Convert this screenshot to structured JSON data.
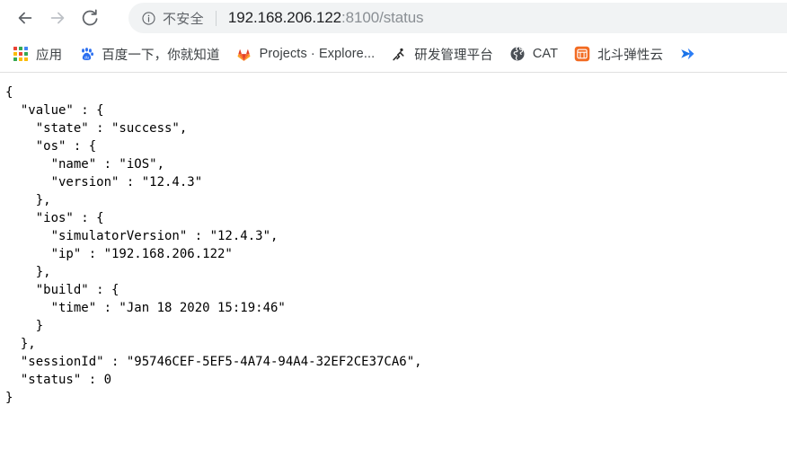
{
  "browser": {
    "nav": {
      "back_label": "Back",
      "back_icon": "arrow-left-icon",
      "forward_label": "Forward",
      "forward_icon": "arrow-right-icon",
      "reload_label": "Reload",
      "reload_icon": "reload-icon"
    },
    "omnibox": {
      "security_icon": "info-circle-icon",
      "security_label": "不安全",
      "url_host": "192.168.206.122",
      "url_rest": ":8100/status",
      "full_url": "192.168.206.122:8100/status"
    },
    "bookmarks": [
      {
        "icon": "apps-grid-icon",
        "label": "应用"
      },
      {
        "icon": "baidu-paw-icon",
        "label": "百度一下，你就知道"
      },
      {
        "icon": "gitlab-fox-icon",
        "label": "Projects · Explore..."
      },
      {
        "icon": "dev-platform-icon",
        "label": "研发管理平台"
      },
      {
        "icon": "globe-icon",
        "label": "CAT"
      },
      {
        "icon": "beidou-cloud-icon",
        "label": "北斗弹性云"
      },
      {
        "icon": "blue-arrow-icon",
        "label": ""
      }
    ]
  },
  "page": {
    "content_type": "json",
    "json_text": "{\n  \"value\" : {\n    \"state\" : \"success\",\n    \"os\" : {\n      \"name\" : \"iOS\",\n      \"version\" : \"12.4.3\"\n    },\n    \"ios\" : {\n      \"simulatorVersion\" : \"12.4.3\",\n      \"ip\" : \"192.168.206.122\"\n    },\n    \"build\" : {\n      \"time\" : \"Jan 18 2020 15:19:46\"\n    }\n  },\n  \"sessionId\" : \"95746CEF-5EF5-4A74-94A4-32EF2CE37CA6\",\n  \"status\" : 0\n}",
    "values": {
      "state": "success",
      "os_name": "iOS",
      "os_version": "12.4.3",
      "ios_simulatorVersion": "12.4.3",
      "ios_ip": "192.168.206.122",
      "build_time": "Jan 18 2020 15:19:46",
      "sessionId": "95746CEF-5EF5-4A74-94A4-32EF2CE37CA6",
      "status": "0"
    }
  },
  "colors": {
    "omnibox_bg": "#f1f3f4",
    "text_primary": "#202124",
    "text_secondary": "#5f6368",
    "url_dim": "#8a8f94",
    "gitlab_orange": "#e24329",
    "baidu_blue": "#2b6ff0",
    "beidou_orange": "#f26b22",
    "blue_arrow": "#1a73e8"
  }
}
